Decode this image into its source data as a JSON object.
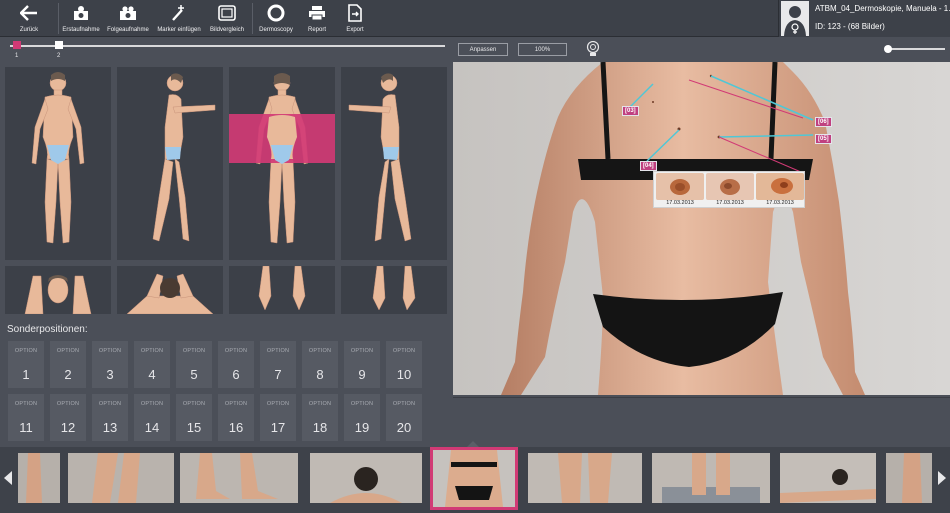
{
  "toolbar": {
    "buttons": [
      {
        "label": "Zurück",
        "icon": "back-arrow-icon"
      },
      {
        "label": "Erstaufnahme",
        "icon": "camera-first-icon"
      },
      {
        "label": "Folgeaufnahme",
        "icon": "camera-follow-icon"
      },
      {
        "label": "Marker einfügen",
        "icon": "marker-add-icon"
      },
      {
        "label": "Bildvergleich",
        "icon": "compare-icon"
      },
      {
        "label": "Dermoscopy",
        "icon": "dermoscopy-icon"
      },
      {
        "label": "Report",
        "icon": "printer-icon"
      },
      {
        "label": "Export",
        "icon": "export-icon"
      }
    ]
  },
  "patient": {
    "name": "ATBM_04_Dermoskopie, Manuela - 1...",
    "id_line": "ID: 123 - (68 Bilder)",
    "gender_icon": "female-icon"
  },
  "timeline": {
    "points": [
      "1",
      "2"
    ],
    "active_color": "#d13a75"
  },
  "sonder": {
    "label": "Sonderpositionen:",
    "option_text": "OPTION",
    "numbers": [
      "1",
      "2",
      "3",
      "4",
      "5",
      "6",
      "7",
      "8",
      "9",
      "10",
      "11",
      "12",
      "13",
      "14",
      "15",
      "16",
      "17",
      "18",
      "19",
      "20"
    ]
  },
  "view": {
    "fit_label": "Anpassen",
    "zoom_label": "100%",
    "markers": [
      "[03]",
      "[04]",
      "[06]",
      "[05]"
    ],
    "dermo_dates": [
      "17.03.2013",
      "17.03.2013",
      "17.03.2013"
    ]
  },
  "colors": {
    "accent": "#d13a75",
    "marker_line": "#4fc7d6"
  }
}
